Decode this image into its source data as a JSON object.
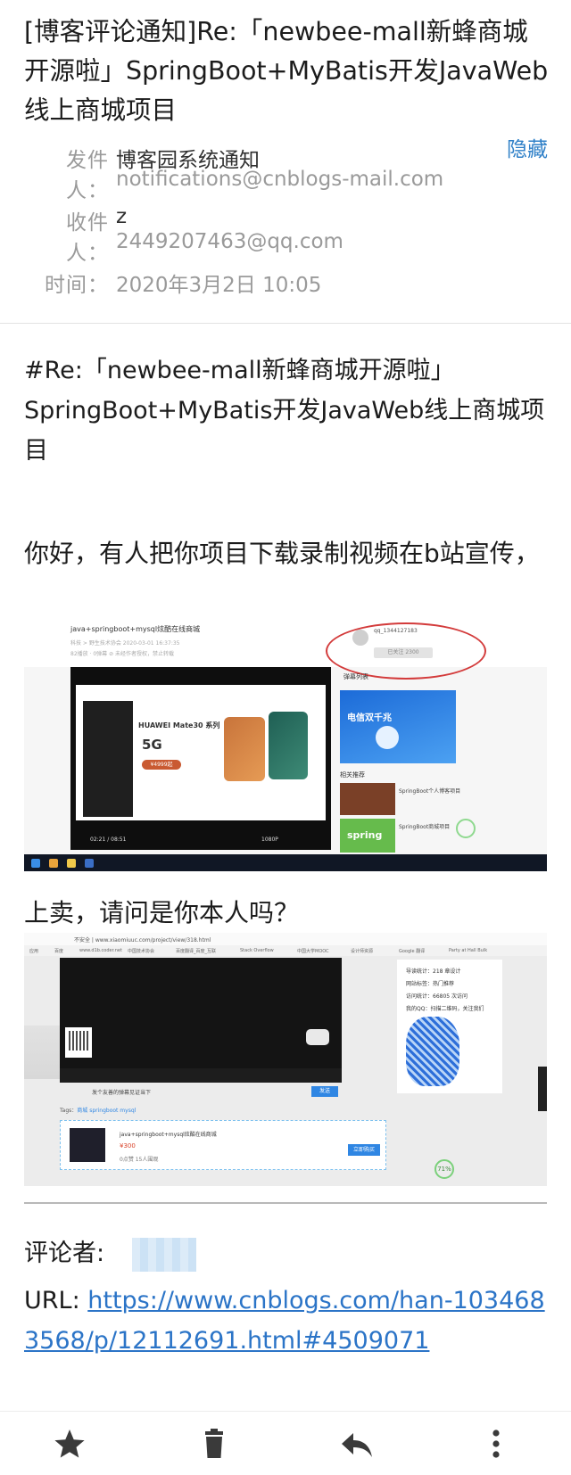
{
  "email": {
    "subject": "[博客评论通知]Re:「newbee-mall新蜂商城开源啦」SpringBoot+MyBatis开发JavaWeb线上商城项目",
    "hide_label": "隐藏",
    "from": {
      "label": "发件人：",
      "name": "博客园系统通知",
      "address": "notifications@cnblogs-mail.com"
    },
    "to": {
      "label": "收件人：",
      "name": "z",
      "address": "2449207463@qq.com"
    },
    "time": {
      "label": "时间：",
      "value": "2020年3月2日 10:05"
    }
  },
  "body": {
    "title": "#Re:「newbee-mall新蜂商城开源啦」SpringBoot+MyBatis开发JavaWeb线上商城项目",
    "greeting": "你好，有人把你项目下载录制视频在b站宣传，",
    "question": "上卖，请问是你本人吗？",
    "commenter_label": "评论者:",
    "url_label": "URL: ",
    "url": "https://www.cnblogs.com/han-1034683568/p/12112691.html#4509071"
  },
  "screenshot1": {
    "video_title": "java+springboot+mysql炫酷在线商城",
    "meta1": "科技 > 野生技术协会    2020-03-01 16:37:35",
    "meta2": "82播放 · 0弹幕    ⊘ 未经作者授权，禁止转载",
    "uploader": "qq_1344127183",
    "follow": "已关注 2300",
    "phone_brand": "HUAWEI Mate30 系列",
    "phone_tag": "5G",
    "price": "¥4999起",
    "time": "02:21 / 08:51",
    "quality": "1080P",
    "danmu": "弹幕列表",
    "ad_title": "电信双千兆",
    "related": "相关推荐",
    "rec1": "SpringBoot个人博客项目",
    "rec2": "SpringBoot商城项目",
    "spring_label": "spring"
  },
  "screenshot2": {
    "url": "不安全 | www.xiaomiuuc.com/project/view/318.html",
    "bookmarks": [
      "应用",
      "百度",
      "www.d1b.coder.net",
      "中国技术协会",
      "百度翻译_百度_互联",
      "Stack Overflow",
      "中国大学MOOC",
      "设计师资源",
      "Google 翻译",
      "Party at Hall Bulk"
    ],
    "comment_placeholder": "发个友善的弹幕见证当下",
    "send": "发送",
    "tags": "Tags：",
    "tag_values": "商城 springboot mysql",
    "card_title": "java+springboot+mysql炫酷在线商城",
    "card_price": "¥300",
    "card_stats": "0点赞 15人围观",
    "buy": "立即购买",
    "side_rows": [
      "导读统计：218 章设计",
      "网站标签：热门推荐",
      "访问统计：66805 次访问",
      "我的QQ：扫描二维码，关注我们"
    ],
    "badge": "71%"
  }
}
